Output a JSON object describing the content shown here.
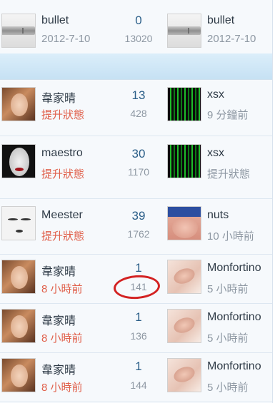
{
  "top_row": {
    "left": {
      "avatar": "bullet-avatar",
      "name": "bullet",
      "sub": "2012-7-10"
    },
    "count": "0",
    "sub_count": "13020",
    "right": {
      "avatar": "bullet-avatar",
      "name": "bullet",
      "sub": "2012-7-10"
    }
  },
  "rows": [
    {
      "left": {
        "avatar": "girl-avatar",
        "name": "韋家晴",
        "sub": "提升狀態"
      },
      "count": "13",
      "sub_count": "428",
      "right": {
        "avatar": "matrix-avatar",
        "name": "xsx",
        "sub": "9 分鐘前"
      }
    },
    {
      "left": {
        "avatar": "face-avatar",
        "name": "maestro",
        "sub": "提升狀態"
      },
      "count": "30",
      "sub_count": "1170",
      "right": {
        "avatar": "matrix-avatar",
        "name": "xsx",
        "sub": "提升狀態"
      }
    },
    {
      "left": {
        "avatar": "eyes-avatar",
        "name": "Meester",
        "sub": "提升狀態"
      },
      "count": "39",
      "sub_count": "1762",
      "right": {
        "avatar": "skin-avatar",
        "name": "nuts",
        "sub": "10 小時前"
      }
    },
    {
      "left": {
        "avatar": "girl-avatar",
        "name": "韋家晴",
        "sub": "8 小時前"
      },
      "count": "1",
      "sub_count": "141",
      "right": {
        "avatar": "foot-avatar",
        "name": "Monfortino",
        "sub": "5 小時前"
      }
    },
    {
      "left": {
        "avatar": "girl-avatar",
        "name": "韋家晴",
        "sub": "8 小時前"
      },
      "count": "1",
      "sub_count": "136",
      "right": {
        "avatar": "foot-avatar",
        "name": "Monfortino",
        "sub": "5 小時前"
      }
    },
    {
      "left": {
        "avatar": "girl-avatar",
        "name": "韋家晴",
        "sub": "8 小時前"
      },
      "count": "1",
      "sub_count": "144",
      "right": {
        "avatar": "foot-avatar",
        "name": "Monfortino",
        "sub": "5 小時前"
      }
    }
  ],
  "colors": {
    "count": "#2a5e88",
    "status_red": "#e0604b",
    "muted": "#8e98a3",
    "annotation": "#d32222"
  }
}
